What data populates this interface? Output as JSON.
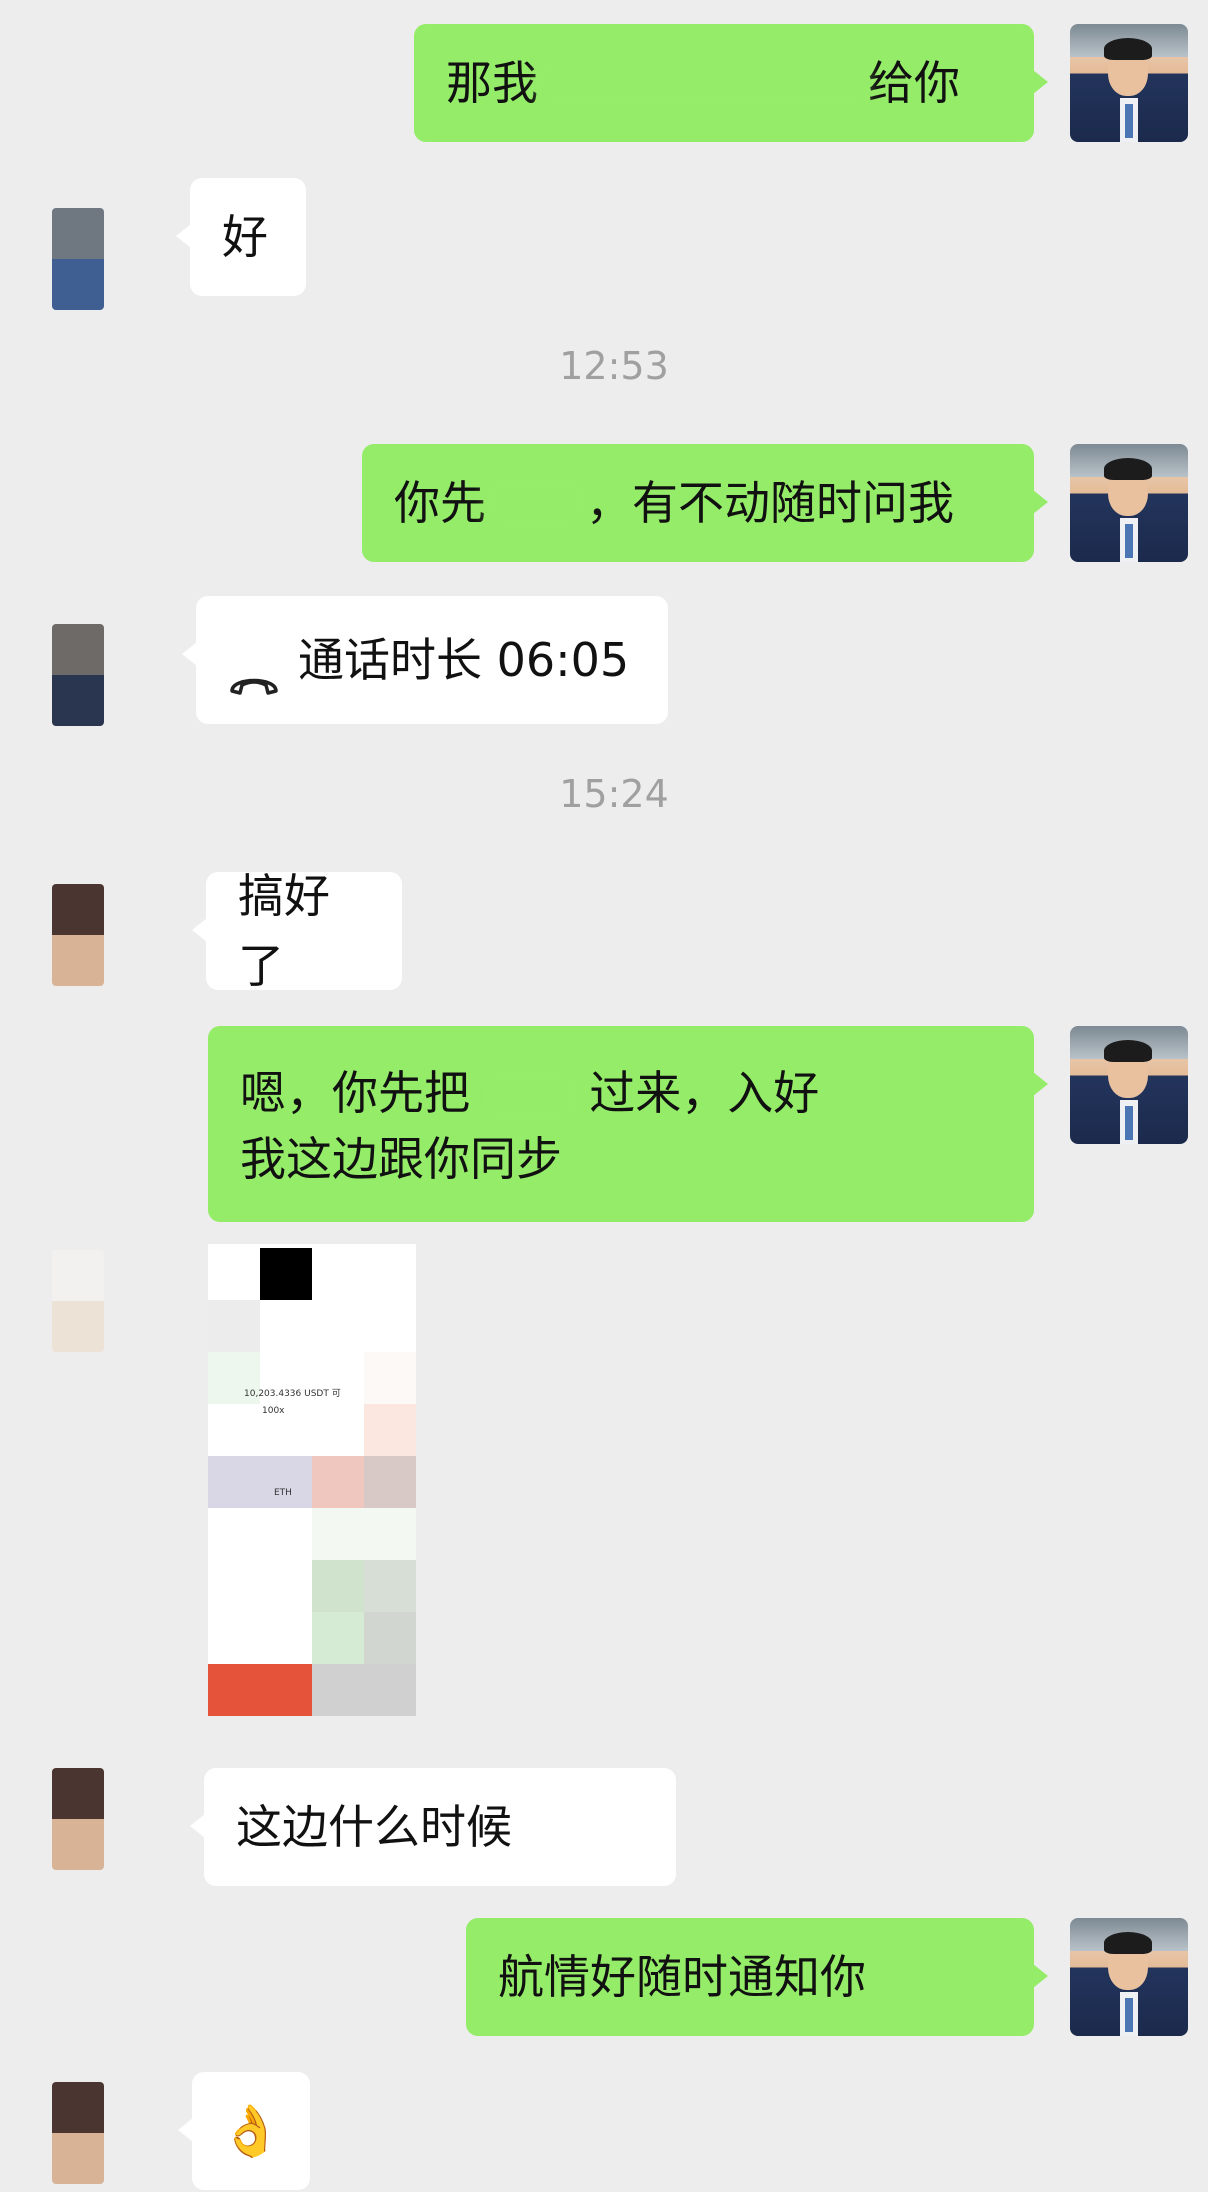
{
  "messages": {
    "m1": {
      "text_start": "那我",
      "text_end": "给你"
    },
    "m2": {
      "text": "好"
    },
    "t1": "12:53",
    "m3": {
      "text_start": "你先",
      "text_end": "，有不动随时问我"
    },
    "m4": {
      "call_label": "通话时长 06:05",
      "icon": "hangup-phone-icon"
    },
    "t2": "15:24",
    "m5": {
      "text": "搞好了"
    },
    "m6": {
      "line1_a": "嗯，你先把",
      "line1_b": "过来，入好",
      "line2": "我这边跟你同步"
    },
    "m7": {
      "usdt_text": "10,203.4336 USDT 可",
      "leverage": "100x",
      "pair": "ETH"
    },
    "m8": {
      "text": "这边什么时候"
    },
    "m9": {
      "text": "航情好随时通知你"
    },
    "m10": {
      "emoji": "👌"
    }
  },
  "colors": {
    "background": "#ededed",
    "my_bubble": "#95ec69",
    "other_bubble": "#ffffff",
    "timestamp": "#a0a0a0"
  }
}
